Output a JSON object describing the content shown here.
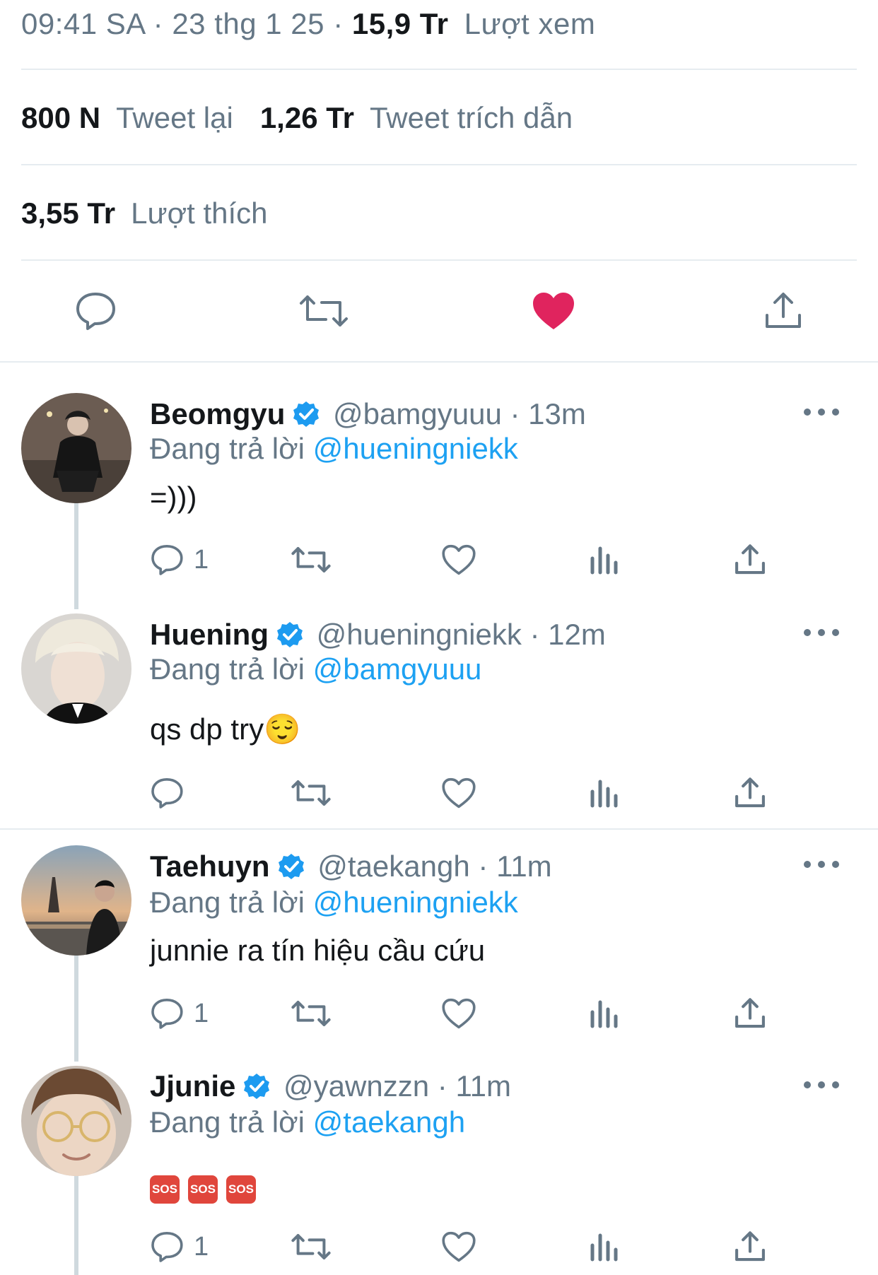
{
  "tweet": {
    "time": "09:41 SA",
    "date": "23 thg 1 25",
    "views_count": "15,9 Tr",
    "views_label": "Lượt xem",
    "retweets_count": "800 N",
    "retweets_label": "Tweet lại",
    "quotes_count": "1,26 Tr",
    "quotes_label": "Tweet trích dẫn",
    "likes_count": "3,55 Tr",
    "likes_label": "Lượt thích",
    "liked": true
  },
  "colors": {
    "like_active": "#e0245e",
    "mention": "#1da1f2",
    "muted": "#657786",
    "verified": "#1d9bf0",
    "sos": "#e0463c"
  },
  "icons": [
    "reply-icon",
    "retweet-icon",
    "like-icon",
    "share-icon",
    "views-icon",
    "more-icon",
    "verified-icon"
  ],
  "replies": [
    {
      "name": "Beomgyu",
      "handle": "@bamgyuuu",
      "time": "13m",
      "replying_label": "Đang trả lời",
      "replying_to": "@hueningniekk",
      "text": "=)))",
      "reply_count": "1"
    },
    {
      "name": "Huening",
      "handle": "@hueningniekk",
      "time": "12m",
      "replying_label": "Đang trả lời",
      "replying_to": "@bamgyuuu",
      "text": "qs dp try",
      "emoji": "😌",
      "reply_count": ""
    },
    {
      "name": "Taehuyn",
      "handle": "@taekangh",
      "time": "11m",
      "replying_label": "Đang trả lời",
      "replying_to": "@hueningniekk",
      "text": "junnie ra tín hiệu cầu cứu",
      "reply_count": "1"
    },
    {
      "name": "Jjunie",
      "handle": "@yawnzzn",
      "time": "11m",
      "replying_label": "Đang trả lời",
      "replying_to": "@taekangh",
      "sos_label": "SOS",
      "reply_count": "1"
    }
  ],
  "separators": {
    "dot": "·"
  }
}
